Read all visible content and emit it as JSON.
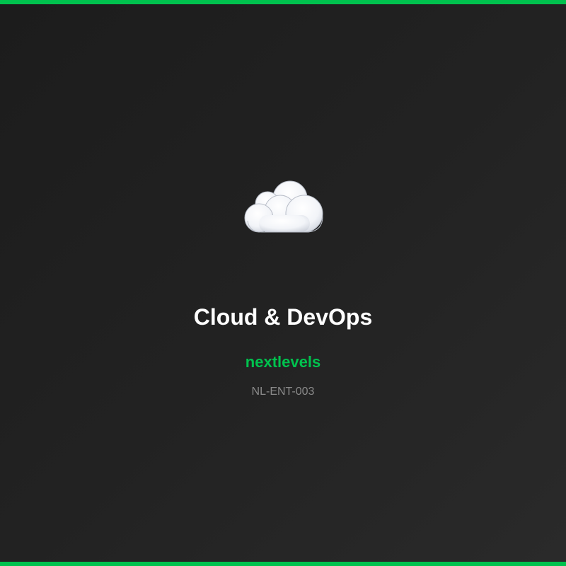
{
  "colors": {
    "accent": "#00c24e",
    "background": "#222222",
    "title": "#ffffff",
    "code": "#8a8a8a"
  },
  "hero": {
    "icon": "cloud-icon",
    "title": "Cloud & DevOps",
    "brand": "nextlevels",
    "code": "NL-ENT-003"
  }
}
